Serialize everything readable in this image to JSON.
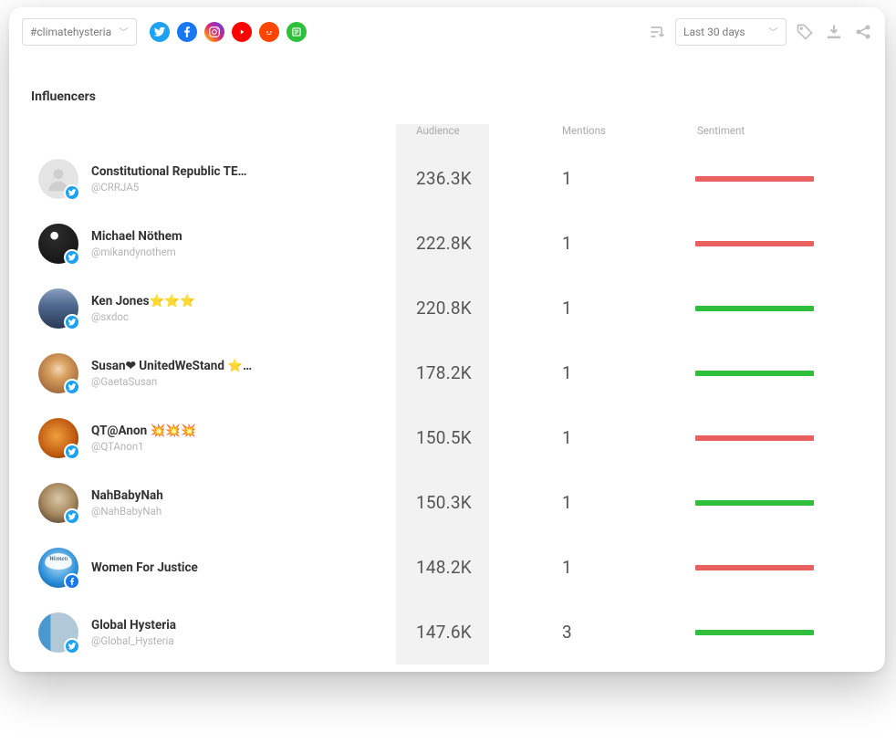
{
  "topbar": {
    "hashtag_dropdown": "#climatehysteria",
    "date_dropdown": "Last 30 days"
  },
  "panel": {
    "title": "Influencers"
  },
  "headers": {
    "audience": "Audience",
    "mentions": "Mentions",
    "sentiment": "Sentiment"
  },
  "socials": [
    {
      "name": "twitter",
      "bg": "#1da1f2"
    },
    {
      "name": "facebook",
      "bg": "#1877f2"
    },
    {
      "name": "instagram",
      "bg": "linear-gradient(45deg,#feda75,#fa7e1e,#d62976,#962fbf,#4f5bd5)"
    },
    {
      "name": "youtube",
      "bg": "#ff0000"
    },
    {
      "name": "reddit",
      "bg": "#ff4500"
    },
    {
      "name": "news",
      "bg": "#2fbf3a"
    }
  ],
  "rows": [
    {
      "name": "Constitutional Republic TE…",
      "handle": "@CRRJA5",
      "audience": "236.3K",
      "mentions": "1",
      "sentiment": "neg",
      "avatar": "av-gray",
      "platform": "twitter"
    },
    {
      "name": "Michael Nöthem",
      "handle": "@mikandynothem",
      "audience": "222.8K",
      "mentions": "1",
      "sentiment": "neg",
      "avatar": "av-img1",
      "platform": "twitter"
    },
    {
      "name": "Ken Jones⭐⭐⭐",
      "handle": "@sxdoc",
      "audience": "220.8K",
      "mentions": "1",
      "sentiment": "pos",
      "avatar": "av-flag",
      "platform": "twitter"
    },
    {
      "name": "Susan❤ UnitedWeStand ⭐…",
      "handle": "@GaetaSusan",
      "audience": "178.2K",
      "mentions": "1",
      "sentiment": "pos",
      "avatar": "av-susan",
      "platform": "twitter"
    },
    {
      "name": "QT@Anon 💥💥💥",
      "handle": "@QTAnon1",
      "audience": "150.5K",
      "mentions": "1",
      "sentiment": "neg",
      "avatar": "av-qt",
      "platform": "twitter"
    },
    {
      "name": "NahBabyNah",
      "handle": "@NahBabyNah",
      "audience": "150.3K",
      "mentions": "1",
      "sentiment": "pos",
      "avatar": "av-nah",
      "platform": "twitter"
    },
    {
      "name": "Women For Justice",
      "handle": "",
      "audience": "148.2K",
      "mentions": "1",
      "sentiment": "neg",
      "avatar": "av-women",
      "platform": "facebook"
    },
    {
      "name": "Global Hysteria",
      "handle": "@Global_Hysteria",
      "audience": "147.6K",
      "mentions": "3",
      "sentiment": "pos",
      "avatar": "av-global",
      "platform": "twitter"
    }
  ],
  "platform_colors": {
    "twitter": "#1da1f2",
    "facebook": "#1877f2"
  }
}
